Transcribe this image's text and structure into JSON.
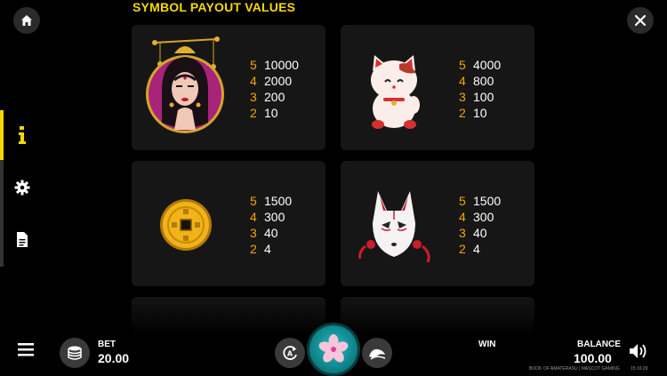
{
  "title": "SYMBOL PAYOUT VALUES",
  "icons": {
    "home": "home-icon",
    "close": "close-icon",
    "info": "info-icon",
    "settings": "gear-icon",
    "rules": "document-icon",
    "menu": "hamburger-icon",
    "bet": "coins-icon",
    "autoplay": "autoplay-icon",
    "spin": "sakura-flower-icon",
    "turbo": "turbo-icon",
    "sound": "speaker-icon"
  },
  "colors": {
    "accent": "#f5d800",
    "count": "#f5a800",
    "card": "#161616",
    "spin": "#1aa3aa"
  },
  "symbols": [
    {
      "name": "geisha",
      "payouts": [
        {
          "count": "5",
          "value": "10000"
        },
        {
          "count": "4",
          "value": "2000"
        },
        {
          "count": "3",
          "value": "200"
        },
        {
          "count": "2",
          "value": "10"
        }
      ]
    },
    {
      "name": "lucky-cat",
      "payouts": [
        {
          "count": "5",
          "value": "4000"
        },
        {
          "count": "4",
          "value": "800"
        },
        {
          "count": "3",
          "value": "100"
        },
        {
          "count": "2",
          "value": "10"
        }
      ]
    },
    {
      "name": "gold-coin",
      "payouts": [
        {
          "count": "5",
          "value": "1500"
        },
        {
          "count": "4",
          "value": "300"
        },
        {
          "count": "3",
          "value": "40"
        },
        {
          "count": "2",
          "value": "4"
        }
      ]
    },
    {
      "name": "kitsune-mask",
      "payouts": [
        {
          "count": "5",
          "value": "1500"
        },
        {
          "count": "4",
          "value": "300"
        },
        {
          "count": "3",
          "value": "40"
        },
        {
          "count": "2",
          "value": "4"
        }
      ]
    }
  ],
  "bottom": {
    "bet_label": "BET",
    "bet_value": "20.00",
    "win_label": "WIN",
    "balance_label": "BALANCE",
    "balance_value": "100.00",
    "footer": "BOOK OF AMATERASU | MASCOT GAMING",
    "clock": "15:16:29"
  }
}
